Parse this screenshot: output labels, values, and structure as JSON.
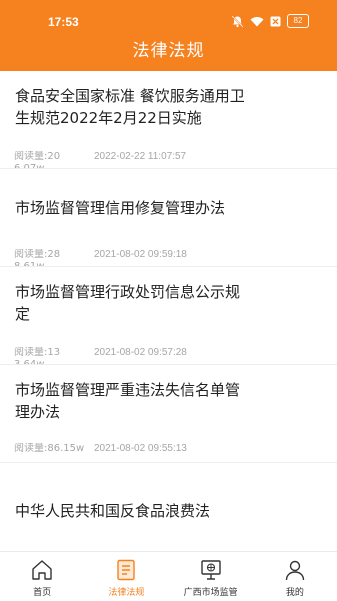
{
  "status": {
    "time": "17:53",
    "battery": "82"
  },
  "header": {
    "title": "法律法规"
  },
  "articles": [
    {
      "title": "食品安全国家标准  餐饮服务通用卫生规范2022年2月22日实施",
      "reads": "阅读量:206.07w",
      "date": "2022-02-22 11:07:57"
    },
    {
      "title": "市场监督管理信用修复管理办法",
      "reads": "阅读量:288.61w",
      "date": "2021-08-02 09:59:18"
    },
    {
      "title": "市场监督管理行政处罚信息公示规定",
      "reads": "阅读量:133.64w",
      "date": "2021-08-02 09:57:28"
    },
    {
      "title": "市场监督管理严重违法失信名单管理办法",
      "reads": "阅读量:86.15w",
      "date": "2021-08-02 09:55:13"
    },
    {
      "title": "中华人民共和国反食品浪费法",
      "reads": "",
      "date": ""
    }
  ],
  "tabbar": [
    {
      "label": "首页",
      "icon": "home-icon",
      "active": false
    },
    {
      "label": "法律法规",
      "icon": "document-icon",
      "active": true
    },
    {
      "label": "广西市场监管",
      "icon": "monitor-globe-icon",
      "active": false
    },
    {
      "label": "我的",
      "icon": "user-icon",
      "active": false
    }
  ],
  "colors": {
    "accent": "#f5811f",
    "text": "#222222",
    "muted": "#a6a6a6"
  }
}
